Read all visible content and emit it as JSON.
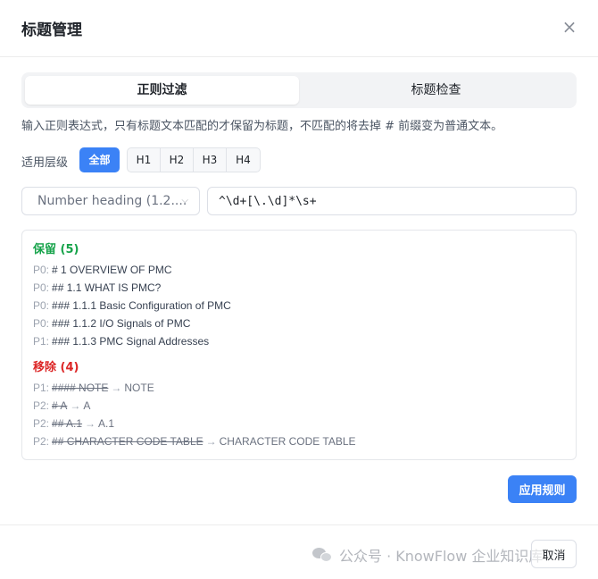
{
  "dialog": {
    "title": "标题管理",
    "close_glyph": "×"
  },
  "tabs": [
    {
      "label": "正则过滤",
      "active": true
    },
    {
      "label": "标题检查",
      "active": false
    }
  ],
  "description": "输入正则表达式，只有标题文本匹配的才保留为标题，不匹配的将去掉 # 前缀变为普通文本。",
  "levels": {
    "label": "适用层级",
    "all_label": "全部",
    "options": [
      "H1",
      "H2",
      "H3",
      "H4"
    ]
  },
  "preset": {
    "selected": "Number heading (1.2....",
    "chevron_icon": "chevron-down-icon"
  },
  "regex": {
    "value": "^\\d+[\\.\\d]*\\s+"
  },
  "preview": {
    "keep": {
      "title": "保留 (5)",
      "items": [
        {
          "priority": "P0:",
          "text": "# 1 OVERVIEW OF PMC"
        },
        {
          "priority": "P0:",
          "text": "## 1.1 WHAT IS PMC?"
        },
        {
          "priority": "P0:",
          "text": "### 1.1.1 Basic Configuration of PMC"
        },
        {
          "priority": "P0:",
          "text": "### 1.1.2 I/O Signals of PMC"
        },
        {
          "priority": "P1:",
          "text": "### 1.1.3 PMC Signal Addresses"
        }
      ]
    },
    "remove": {
      "title": "移除 (4)",
      "arrow": "→",
      "items": [
        {
          "priority": "P1:",
          "original": "#### NOTE",
          "result": "NOTE"
        },
        {
          "priority": "P2:",
          "original": "# A",
          "result": "A"
        },
        {
          "priority": "P2:",
          "original": "## A.1",
          "result": "A.1"
        },
        {
          "priority": "P2:",
          "original": "## CHARACTER CODE TABLE",
          "result": "CHARACTER CODE TABLE"
        }
      ]
    }
  },
  "actions": {
    "apply_label": "应用规则",
    "cancel_label": "取消"
  },
  "watermark": {
    "text": "公众号 · KnowFlow 企业知识库"
  },
  "colors": {
    "primary": "#3b82f6",
    "keep": "#16a34a",
    "remove": "#dc2626"
  }
}
